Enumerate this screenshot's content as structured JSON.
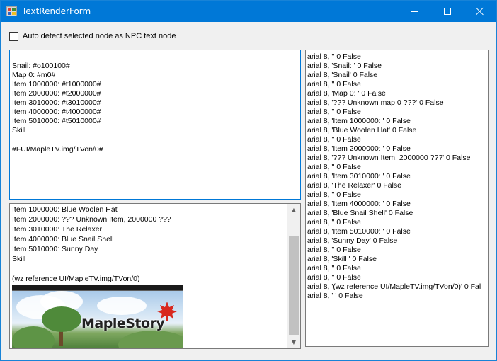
{
  "window": {
    "title": "TextRenderForm"
  },
  "options": {
    "auto_detect_label": "Auto detect selected node as NPC text node",
    "auto_detect_checked": false
  },
  "editor": {
    "lines": [
      "Snail: #o100100#",
      "Map 0: #m0#",
      "Item 1000000: #t1000000#",
      "Item 2000000: #t2000000#",
      "Item 3010000: #t3010000#",
      "Item 4000000: #t4000000#",
      "Item 5010000: #t5010000#",
      "Skill",
      "",
      "#FUI/MapleTV.img/TVon/0#"
    ]
  },
  "preview": {
    "lines": [
      "Item 1000000: Blue Woolen Hat",
      "Item 2000000: ??? Unknown Item, 2000000 ???",
      "Item 3010000: The Relaxer",
      "Item 4000000: Blue Snail Shell",
      "Item 5010000: Sunny Day",
      "Skill",
      "",
      "(wz reference UI/MapleTV.img/TVon/0)"
    ],
    "banner_logo": "MapleStory"
  },
  "colors": {
    "title_bar": "#0078d7",
    "focus_border": "#0078d7",
    "logo_leaf": "#d8281e"
  },
  "log": {
    "rows": [
      "arial 8, '' 0 False",
      "arial 8, 'Snail: ' 0 False",
      "arial 8, 'Snail' 0 False",
      "arial 8, '' 0 False",
      "arial 8, 'Map 0: ' 0 False",
      "arial 8, '??? Unknown map 0 ???' 0 False",
      "arial 8, '' 0 False",
      "arial 8, 'Item 1000000: ' 0 False",
      "arial 8, 'Blue Woolen Hat' 0 False",
      "arial 8, '' 0 False",
      "arial 8, 'Item 2000000: ' 0 False",
      "arial 8, '??? Unknown Item, 2000000 ???' 0 False",
      "arial 8, '' 0 False",
      "arial 8, 'Item 3010000: ' 0 False",
      "arial 8, 'The Relaxer' 0 False",
      "arial 8, '' 0 False",
      "arial 8, 'Item 4000000: ' 0 False",
      "arial 8, 'Blue Snail Shell' 0 False",
      "arial 8, '' 0 False",
      "arial 8, 'Item 5010000: ' 0 False",
      "arial 8, 'Sunny Day' 0 False",
      "arial 8, '' 0 False",
      "arial 8, 'Skill ' 0 False",
      "arial 8, '' 0 False",
      "arial 8, '' 0 False",
      "arial 8, '(wz reference UI/MapleTV.img/TVon/0)' 0 Fal",
      "arial 8, ' ' 0 False"
    ]
  }
}
